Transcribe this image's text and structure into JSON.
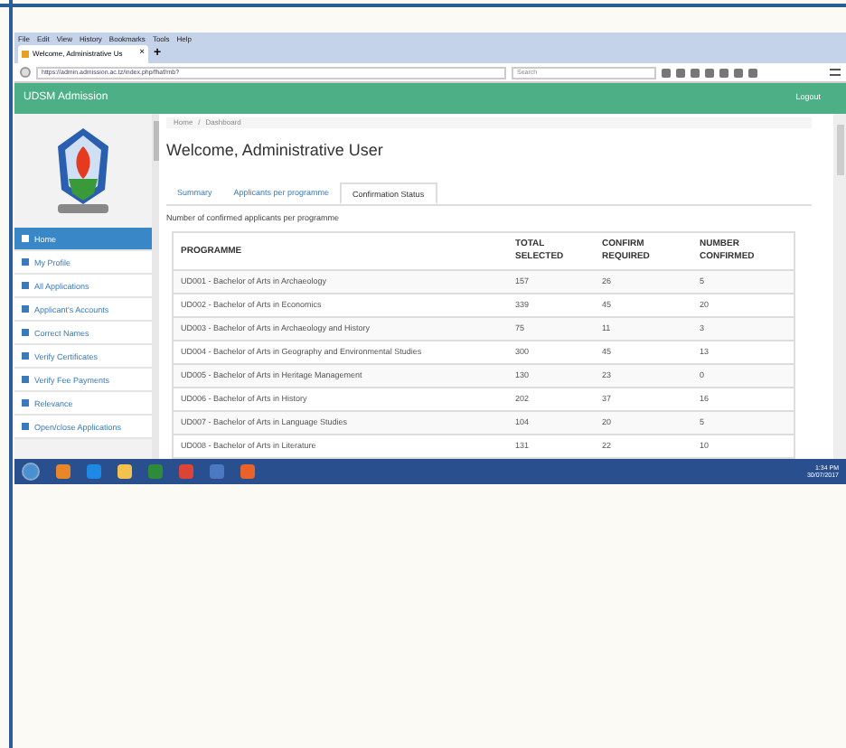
{
  "browser": {
    "menu": [
      "File",
      "Edit",
      "View",
      "History",
      "Bookmarks",
      "Tools",
      "Help"
    ],
    "tab": {
      "title": "Welcome, Administrative Us",
      "close": "×",
      "selected": true
    },
    "new_tab": "+",
    "url": "https://admin.admission.ac.tz/index.php/fhaf/rnb?",
    "search": {
      "placeholder": "Search"
    }
  },
  "header": {
    "title": "UDSM Admission",
    "logout": "Logout"
  },
  "sidebar": {
    "items": [
      {
        "label": "Home",
        "selected": true
      },
      {
        "label": "My Profile",
        "selected": false
      },
      {
        "label": "All Applications",
        "selected": false
      },
      {
        "label": "Applicant's Accounts",
        "selected": false
      },
      {
        "label": "Correct Names",
        "selected": false
      },
      {
        "label": "Verify Certificates",
        "selected": false
      },
      {
        "label": "Verify Fee Payments",
        "selected": false
      },
      {
        "label": "Relevance",
        "selected": false
      },
      {
        "label": "Open/close Applications",
        "selected": false
      }
    ]
  },
  "breadcrumb": [
    "Home",
    "/",
    "Dashboard"
  ],
  "page_title": "Welcome, Administrative User",
  "tabs": [
    {
      "label": "Summary",
      "selected": false
    },
    {
      "label": "Applicants per programme",
      "selected": false
    },
    {
      "label": "Confirmation Status",
      "selected": true
    }
  ],
  "caption": "Number of confirmed applicants per programme",
  "table": {
    "columns": [
      "PROGRAMME",
      "TOTAL SELECTED",
      "CONFIRM REQUIRED",
      "NUMBER CONFIRMED"
    ],
    "rows": [
      [
        "UD001 - Bachelor of Arts in Archaeology",
        "157",
        "26",
        "5"
      ],
      [
        "UD002 - Bachelor of Arts in Economics",
        "339",
        "45",
        "20"
      ],
      [
        "UD003 - Bachelor of Arts in Archaeology and History",
        "75",
        "11",
        "3"
      ],
      [
        "UD004 - Bachelor of Arts in Geography and Environmental Studies",
        "300",
        "45",
        "13"
      ],
      [
        "UD005 - Bachelor of Arts in Heritage Management",
        "130",
        "23",
        "0"
      ],
      [
        "UD006 - Bachelor of Arts in History",
        "202",
        "37",
        "16"
      ],
      [
        "UD007 - Bachelor of Arts in Language Studies",
        "104",
        "20",
        "5"
      ],
      [
        "UD008 - Bachelor of Arts in Literature",
        "131",
        "22",
        "10"
      ]
    ]
  },
  "taskbar": {
    "time": "1:34 PM",
    "date": "30/07/2017"
  }
}
